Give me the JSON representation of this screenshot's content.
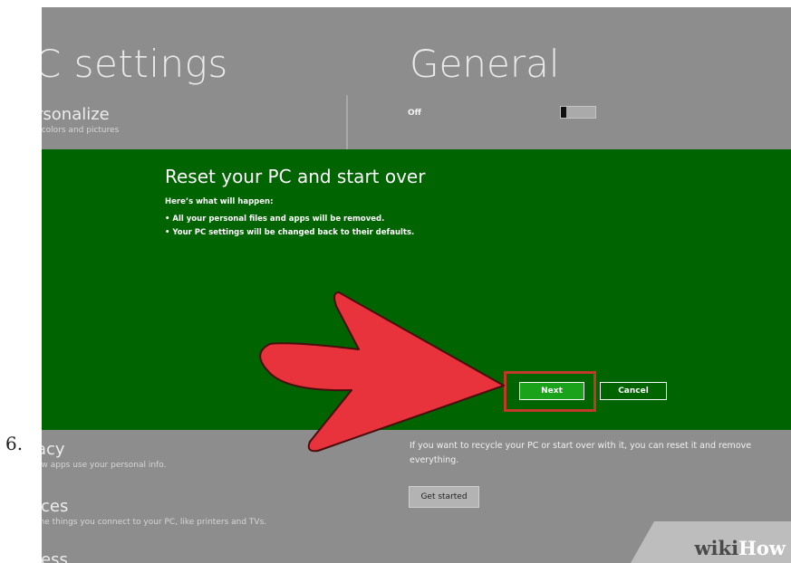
{
  "step_number": "6.",
  "background": {
    "left_title": "C settings",
    "right_title": "General",
    "personalize": {
      "title": "rsonalize",
      "subtitle": ", colors and pictures"
    },
    "privacy": {
      "title": "acy",
      "subtitle": "ow apps use your personal info."
    },
    "devices": {
      "title": "ices",
      "subtitle": "the things you connect to your PC, like printers and TVs."
    },
    "wireless": {
      "title": "less"
    },
    "toggle": {
      "label": "Off"
    },
    "reset_text": "If you want to recycle your PC or start over with it, you can reset it and remove everything.",
    "get_started_label": "Get started"
  },
  "dialog": {
    "title": "Reset your PC and start over",
    "subtitle": "Here’s what will happen:",
    "bullets": [
      "• All your personal files and apps will be removed.",
      "• Your PC settings will be changed back to their defaults."
    ],
    "next_label": "Next",
    "cancel_label": "Cancel"
  },
  "watermark": {
    "part1": "wiki",
    "part2": "How"
  },
  "colors": {
    "dialog_green": "#006400",
    "next_green": "#1aa31a",
    "highlight_red": "#c0392b",
    "arrow_red": "#e8323c",
    "background_gray": "#8d8d8d"
  },
  "icons": [
    "pointer-arrow-icon"
  ]
}
